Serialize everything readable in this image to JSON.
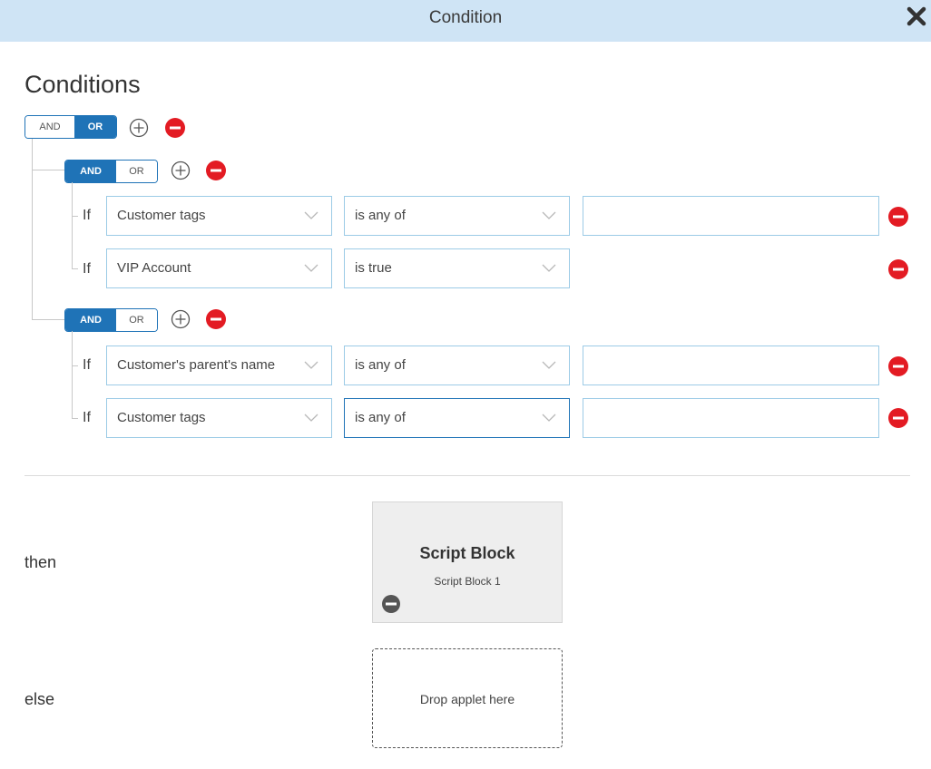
{
  "dialog": {
    "title": "Condition"
  },
  "conditions": {
    "heading": "Conditions",
    "root": {
      "and_label": "AND",
      "or_label": "OR",
      "selected": "OR"
    },
    "groups": [
      {
        "and_label": "AND",
        "or_label": "OR",
        "selected": "AND",
        "rows": [
          {
            "if_label": "If",
            "field": "Customer tags",
            "operator": "is any of",
            "value": ""
          },
          {
            "if_label": "If",
            "field": "VIP Account",
            "operator": "is true"
          }
        ]
      },
      {
        "and_label": "AND",
        "or_label": "OR",
        "selected": "AND",
        "rows": [
          {
            "if_label": "If",
            "field": "Customer's parent's name",
            "operator": "is any of",
            "value": ""
          },
          {
            "if_label": "If",
            "field": "Customer tags",
            "operator": "is any of",
            "value": ""
          }
        ]
      }
    ]
  },
  "then": {
    "label": "then",
    "block": {
      "title": "Script Block",
      "subtitle": "Script Block 1"
    }
  },
  "else": {
    "label": "else",
    "drop_text": "Drop applet here"
  },
  "colors": {
    "header_bg": "#cfe4f5",
    "accent": "#1f73b7",
    "danger": "#e31b23",
    "input_border": "#9ccbe6"
  }
}
